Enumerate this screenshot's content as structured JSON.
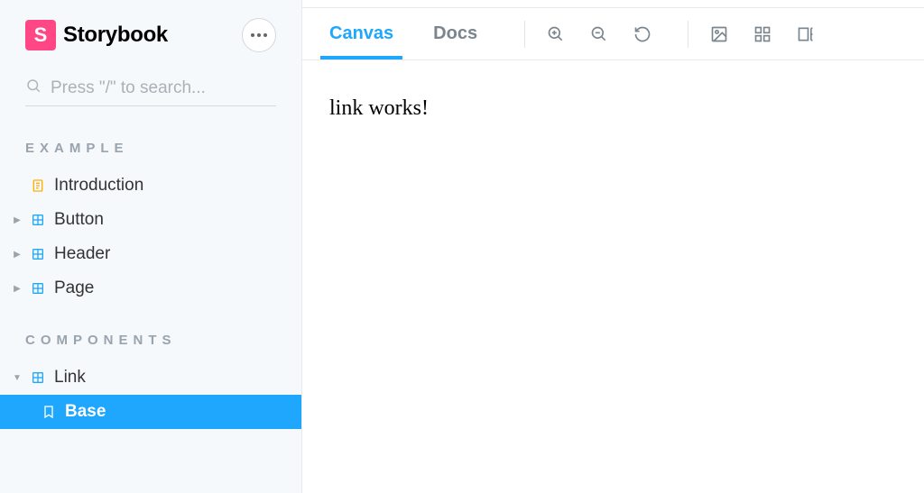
{
  "brand": {
    "title": "Storybook",
    "logo_letter": "S"
  },
  "search": {
    "placeholder": "Press \"/\" to search..."
  },
  "sections": {
    "example": {
      "label": "EXAMPLE",
      "items": {
        "introduction": "Introduction",
        "button": "Button",
        "header": "Header",
        "page": "Page"
      }
    },
    "components": {
      "label": "COMPONENTS",
      "items": {
        "link": "Link",
        "link_base": "Base"
      }
    }
  },
  "tabs": {
    "canvas": "Canvas",
    "docs": "Docs"
  },
  "canvas": {
    "content": "link works!"
  }
}
